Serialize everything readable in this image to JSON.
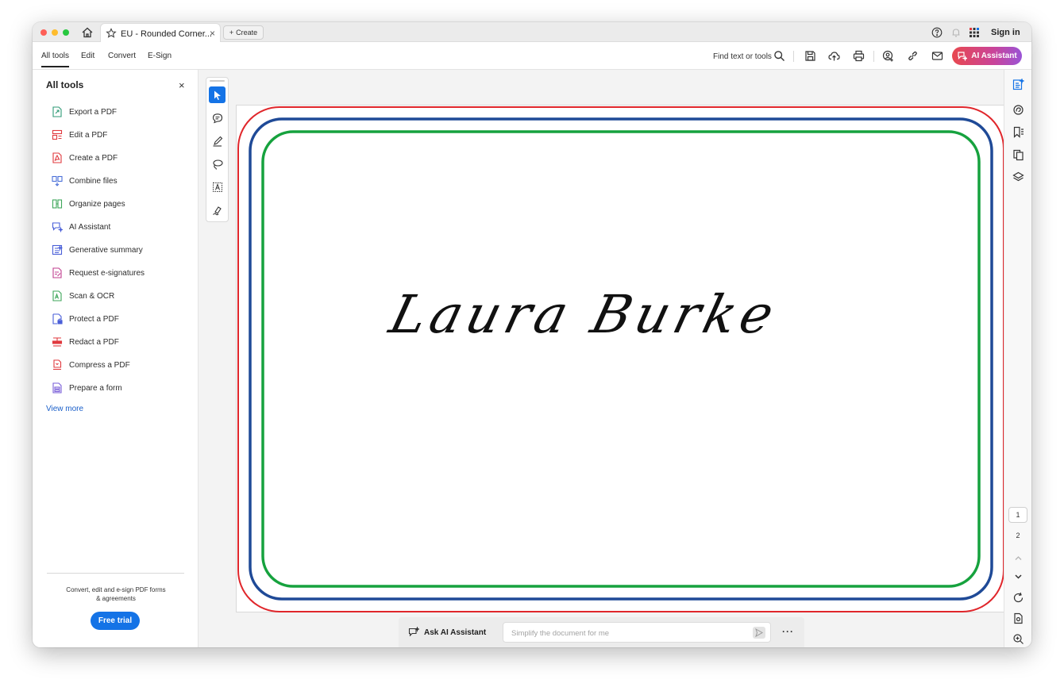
{
  "titlebar": {
    "tab_label": "EU - Rounded Corner...",
    "tab_close": "×",
    "create_label": "Create",
    "sign_in": "Sign in",
    "icons": [
      "home-icon",
      "star-icon",
      "help-icon",
      "bell-icon",
      "apps-grid-icon"
    ]
  },
  "menubar": {
    "items": [
      "All tools",
      "Edit",
      "Convert",
      "E-Sign"
    ],
    "active": "All tools",
    "find_label": "Find text or tools",
    "ai_assistant_label": "AI Assistant",
    "icons": [
      "search-icon",
      "save-icon",
      "upload-icon",
      "print-icon",
      "share-user-icon",
      "link-icon",
      "mail-icon"
    ]
  },
  "leftpanel": {
    "title": "All tools",
    "close": "×",
    "tools": [
      {
        "label": "Export a PDF",
        "icon": "export-pdf-icon",
        "color": "#2f9a76"
      },
      {
        "label": "Edit a PDF",
        "icon": "edit-pdf-icon",
        "color": "#e0393e"
      },
      {
        "label": "Create a PDF",
        "icon": "create-pdf-icon",
        "color": "#e0393e"
      },
      {
        "label": "Combine files",
        "icon": "combine-files-icon",
        "color": "#4a6fd8"
      },
      {
        "label": "Organize pages",
        "icon": "organize-pages-icon",
        "color": "#3ea65a"
      },
      {
        "label": "AI Assistant",
        "icon": "ai-assistant-icon",
        "color": "#4a5fd8"
      },
      {
        "label": "Generative summary",
        "icon": "generative-summary-icon",
        "color": "#4a5fd8"
      },
      {
        "label": "Request e-signatures",
        "icon": "request-esign-icon",
        "color": "#c13f8f"
      },
      {
        "label": "Scan & OCR",
        "icon": "scan-ocr-icon",
        "color": "#3ea65a"
      },
      {
        "label": "Protect a PDF",
        "icon": "protect-pdf-icon",
        "color": "#4a5fd8"
      },
      {
        "label": "Redact a PDF",
        "icon": "redact-pdf-icon",
        "color": "#e0393e"
      },
      {
        "label": "Compress a PDF",
        "icon": "compress-pdf-icon",
        "color": "#e0393e"
      },
      {
        "label": "Prepare a form",
        "icon": "prepare-form-icon",
        "color": "#7a5fd8"
      }
    ],
    "view_more": "View more",
    "promo_line1": "Convert, edit and e-sign PDF forms",
    "promo_line2": "& agreements",
    "free_trial": "Free trial"
  },
  "vtools": {
    "buttons": [
      "select-cursor-icon",
      "comment-icon",
      "pen-icon",
      "lasso-icon",
      "text-box-icon",
      "sign-icon"
    ],
    "active": "select-cursor-icon"
  },
  "document": {
    "signature": "Laura Burke",
    "frame_colors": {
      "outer": "#e0262b",
      "middle": "#1f4a97",
      "inner": "#16a23e"
    }
  },
  "aibar": {
    "ask_label": "Ask AI Assistant",
    "placeholder": "Simplify the document for me",
    "more": "···"
  },
  "rightrail": {
    "icons": [
      "ai-summary-icon",
      "comments-icon",
      "bookmark-icon",
      "pages-icon",
      "layers-icon",
      "chevron-up-icon",
      "chevron-down-icon",
      "rotate-icon",
      "page-fit-icon",
      "zoom-in-icon",
      "zoom-out-icon"
    ],
    "pages": [
      "1",
      "2"
    ],
    "current_page": "1"
  },
  "colors": {
    "accent_blue": "#1473e6",
    "link_blue": "#1a5fc9"
  }
}
